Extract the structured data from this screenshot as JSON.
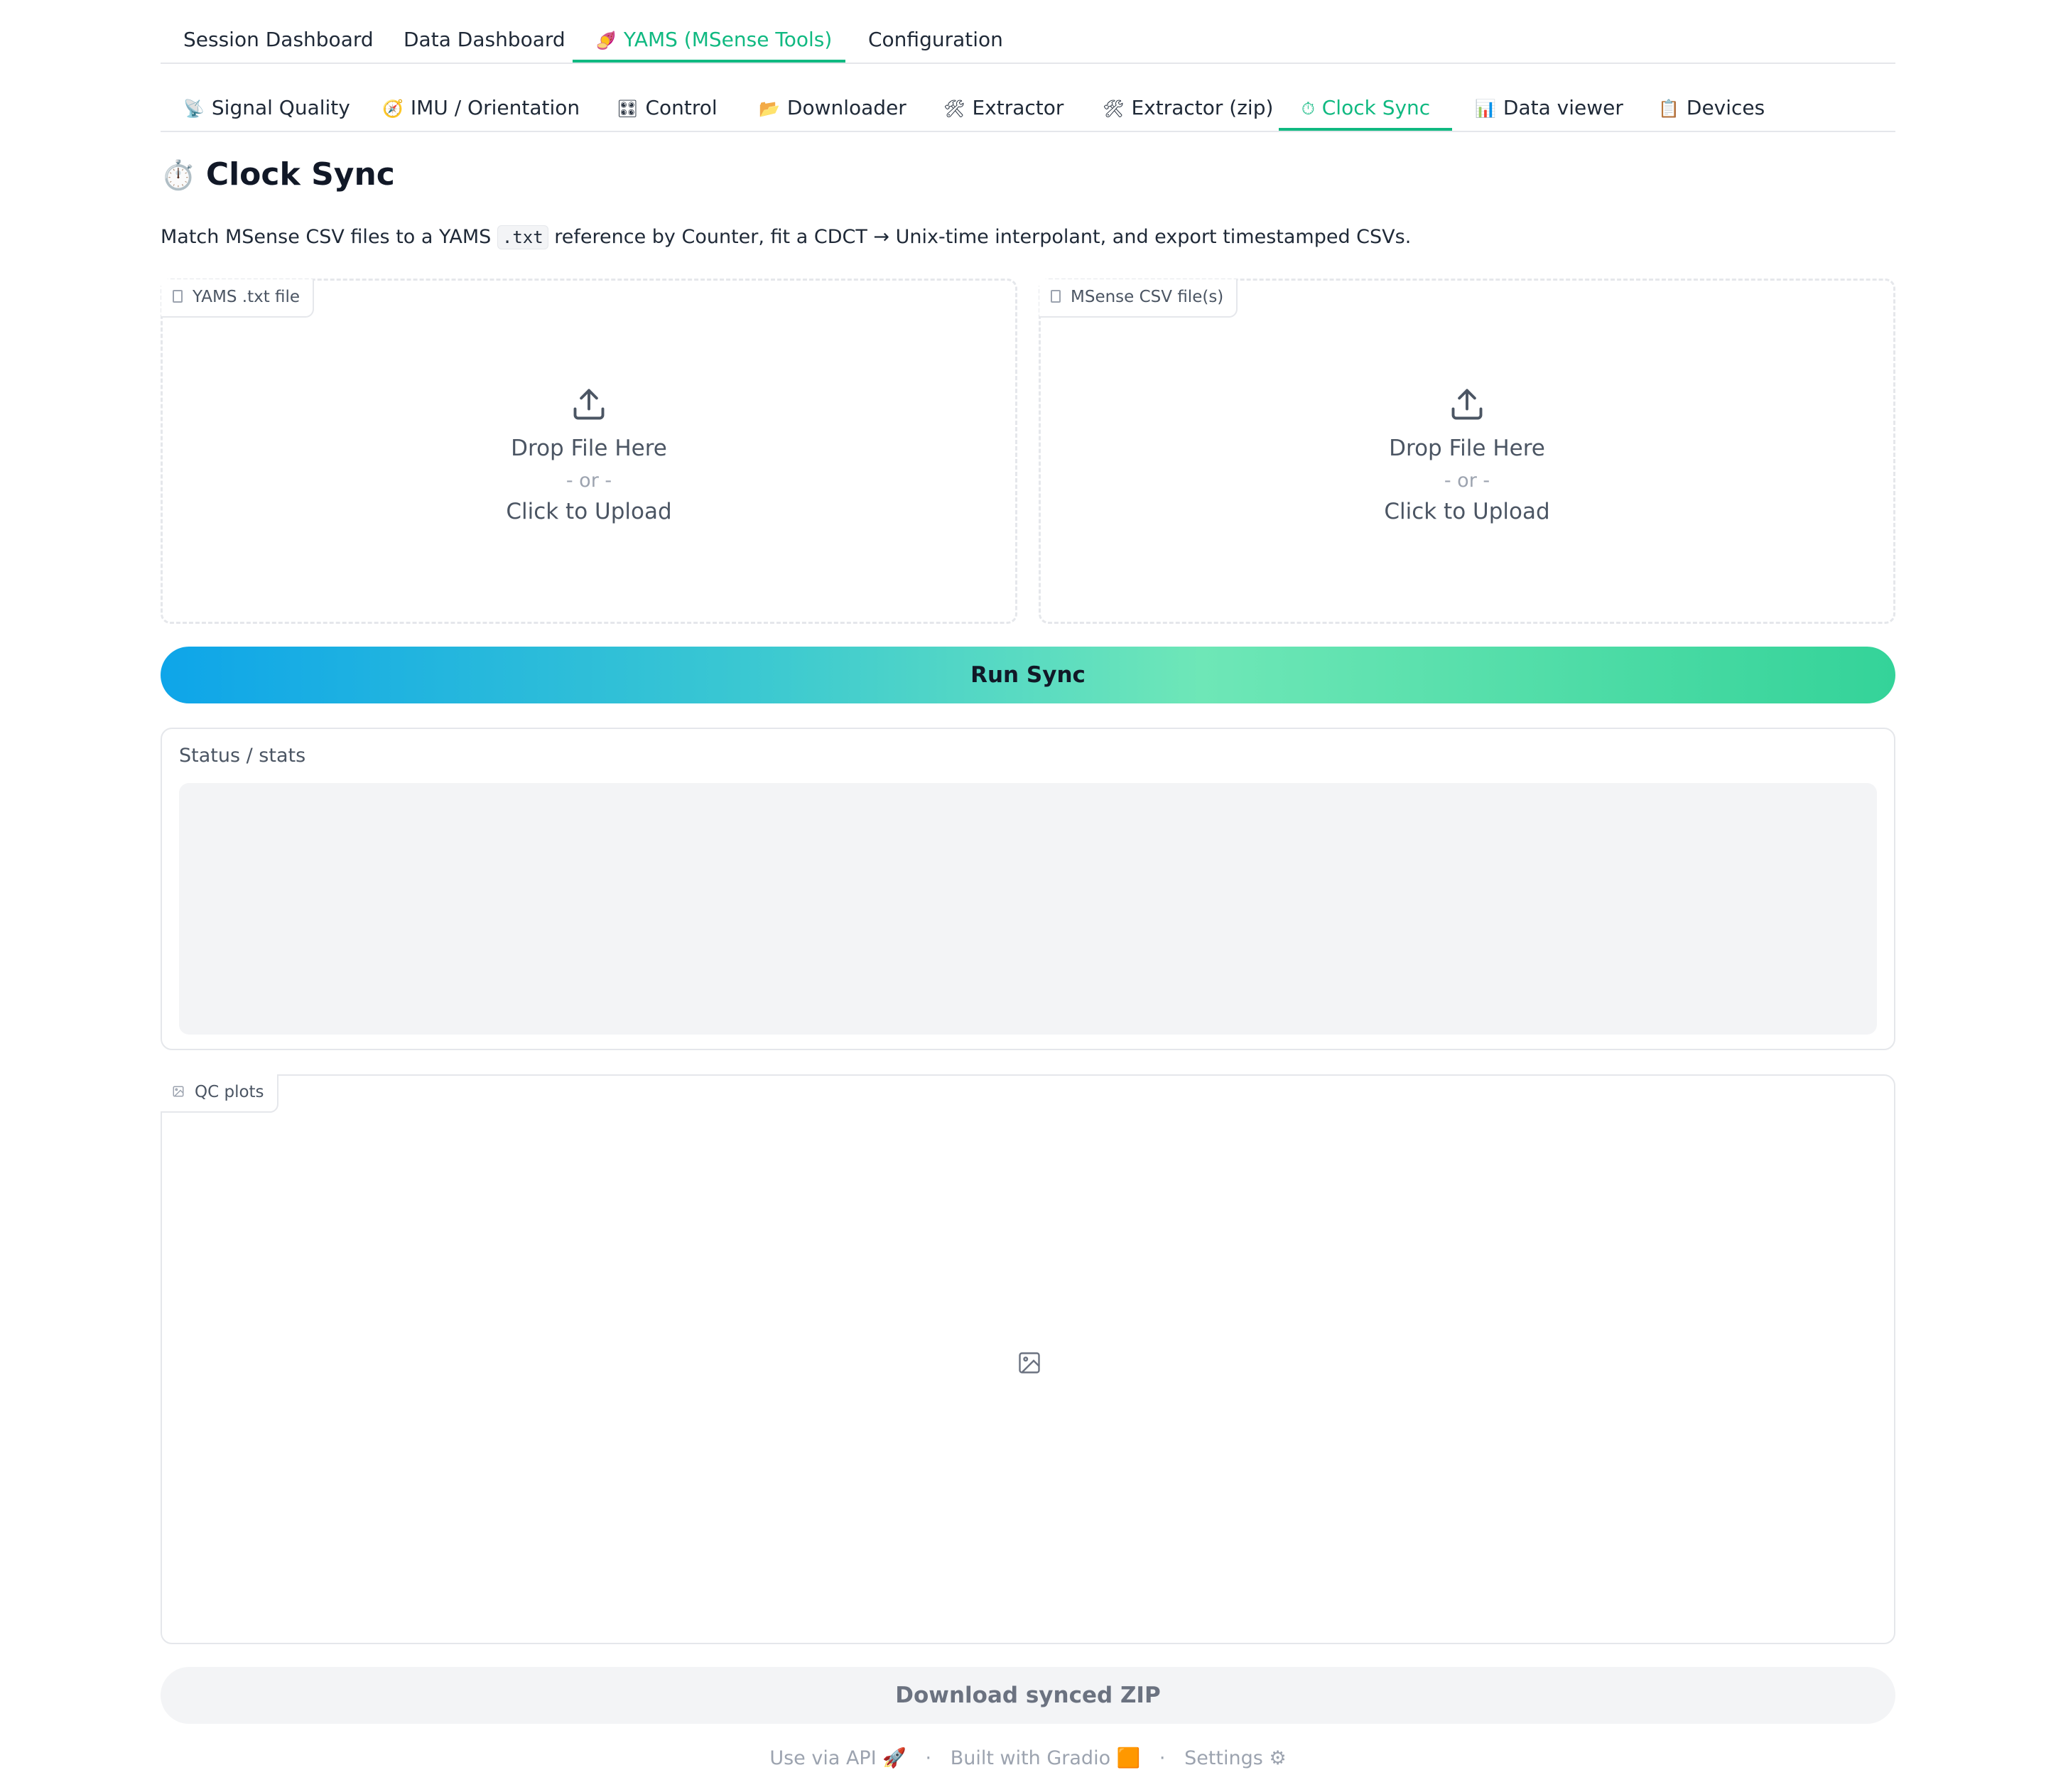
{
  "top_tabs": [
    {
      "label": "Session Dashboard",
      "icon": "",
      "selected": false
    },
    {
      "label": "Data Dashboard",
      "icon": "",
      "selected": false
    },
    {
      "label": "YAMS (MSense Tools)",
      "icon": "🍠",
      "selected": true
    },
    {
      "label": "Configuration",
      "icon": "",
      "selected": false
    }
  ],
  "sub_tabs": [
    {
      "label": "Signal Quality",
      "icon": "📡",
      "selected": false
    },
    {
      "label": "IMU / Orientation",
      "icon": "🧭",
      "selected": false
    },
    {
      "label": "Control",
      "icon": "🎛",
      "selected": false
    },
    {
      "label": "Downloader",
      "icon": "📂",
      "selected": false
    },
    {
      "label": "Extractor",
      "icon": "🛠",
      "selected": false
    },
    {
      "label": "Extractor (zip)",
      "icon": "🛠",
      "selected": false
    },
    {
      "label": "Clock Sync",
      "icon": "⏱",
      "selected": true
    },
    {
      "label": "Data viewer",
      "icon": "📊",
      "selected": false
    },
    {
      "label": "Devices",
      "icon": "📋",
      "selected": false
    }
  ],
  "page": {
    "title_icon": "⏱️",
    "title": "Clock Sync",
    "desc_before": "Match MSense CSV files to a YAMS ",
    "desc_code": ".txt",
    "desc_after": " reference by Counter, fit a CDCT → Unix-time interpolant, and export timestamped CSVs."
  },
  "uploads": {
    "yams": {
      "label": "YAMS .txt file",
      "drop": "Drop File Here",
      "or": "- or -",
      "click": "Click to Upload"
    },
    "msense": {
      "label": "MSense CSV file(s)",
      "drop": "Drop File Here",
      "or": "- or -",
      "click": "Click to Upload"
    }
  },
  "run_button": "Run Sync",
  "status": {
    "label": "Status / stats",
    "value": ""
  },
  "qc": {
    "label": "QC plots"
  },
  "download_button": "Download synced ZIP",
  "footer": {
    "api": "Use via API",
    "api_icon": "🚀",
    "built": "Built with Gradio",
    "built_icon": "🟧",
    "settings": "Settings",
    "settings_icon": "⚙"
  },
  "colors": {
    "accent": "#10b981",
    "gradient_start": "#0ea5e9",
    "gradient_end": "#34d399"
  }
}
